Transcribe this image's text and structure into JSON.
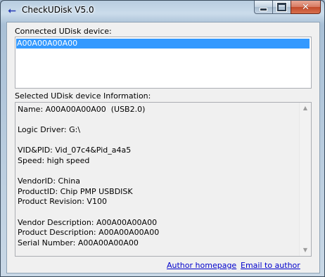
{
  "window": {
    "title": "CheckUDisk V5.0",
    "app_icon": "usb-icon",
    "controls": [
      {
        "name": "minimize",
        "icon": "minimize-icon"
      },
      {
        "name": "maximize",
        "icon": "maximize-icon"
      },
      {
        "name": "close",
        "icon": "close-icon"
      }
    ]
  },
  "connected": {
    "label": "Connected UDisk device:",
    "items": [
      {
        "label": "A00A00A00A00",
        "selected": true
      }
    ]
  },
  "info": {
    "label": "Selected UDisk device Information:",
    "lines": [
      "Name: A00A00A00A00  (USB2.0)",
      "",
      "Logic Driver: G:\\",
      "",
      "VID&PID: Vid_07c4&Pid_a4a5",
      "Speed: high speed",
      "",
      "VendorID: China",
      "ProductID: Chip PMP USBDISK",
      "Product Revision: V100",
      "",
      "Vendor Description: A00A00A00A00",
      "Product Description: A00A00A00A00",
      "Serial Number: A00A00A00A00"
    ],
    "scroll_up_icon": "scroll-up-arrow-icon",
    "scroll_down_icon": "scroll-down-arrow-icon"
  },
  "links": {
    "author_homepage": "Author homepage",
    "email_author": "Email to author"
  },
  "colors": {
    "selection": "#3399ff",
    "link": "#0000cc",
    "close_button": "#c24a2a"
  }
}
